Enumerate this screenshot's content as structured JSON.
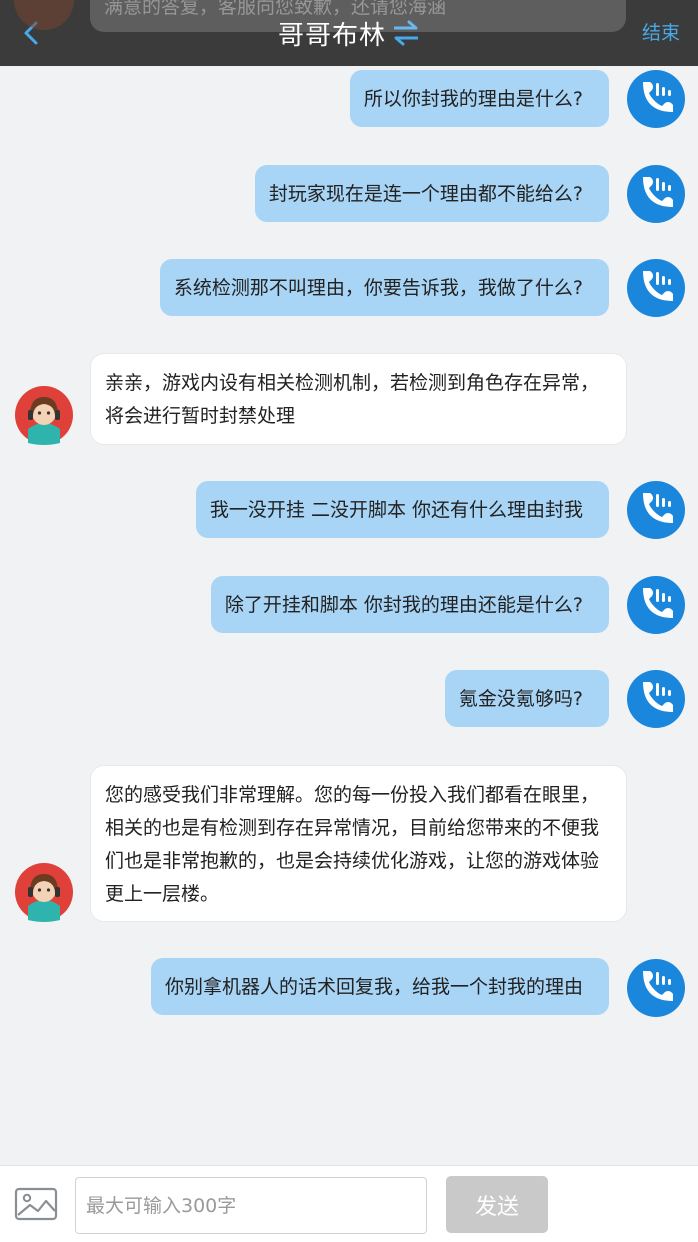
{
  "header": {
    "title": "哥哥布林",
    "end_label": "结束",
    "back_icon": "chevron-left-icon",
    "swap_icon": "swap-arrows-icon",
    "accent_color": "#47a9e8"
  },
  "peek_message": {
    "text": "满意的答复，客服向您致歉，还请您海涵"
  },
  "messages": [
    {
      "side": "out",
      "text": "所以你封我的理由是什么?"
    },
    {
      "side": "out",
      "text": "封玩家现在是连一个理由都不能给么?"
    },
    {
      "side": "out",
      "text": "系统检测那不叫理由，你要告诉我，我做了什么?"
    },
    {
      "side": "in",
      "text": "亲亲，游戏内设有相关检测机制，若检测到角色存在异常，将会进行暂时封禁处理"
    },
    {
      "side": "out",
      "text": "我一没开挂 二没开脚本 你还有什么理由封我"
    },
    {
      "side": "out",
      "text": "除了开挂和脚本 你封我的理由还能是什么?"
    },
    {
      "side": "out",
      "text": "氪金没氪够吗?"
    },
    {
      "side": "in",
      "text": "您的感受我们非常理解。您的每一份投入我们都看在眼里，相关的也是有检测到存在异常情况，目前给您带来的不便我们也是非常抱歉的，也是会持续优化游戏，让您的游戏体验更上一层楼。"
    },
    {
      "side": "out",
      "text": "你别拿机器人的话术回复我，给我一个封我的理由"
    }
  ],
  "composer": {
    "placeholder": "最大可输入300字",
    "send_label": "发送",
    "image_icon": "image-icon"
  },
  "colors": {
    "outgoing_bubble": "#a8d4f5",
    "incoming_bubble": "#ffffff",
    "background": "#f1f2f4",
    "header_bg": "#3b3b3b"
  }
}
